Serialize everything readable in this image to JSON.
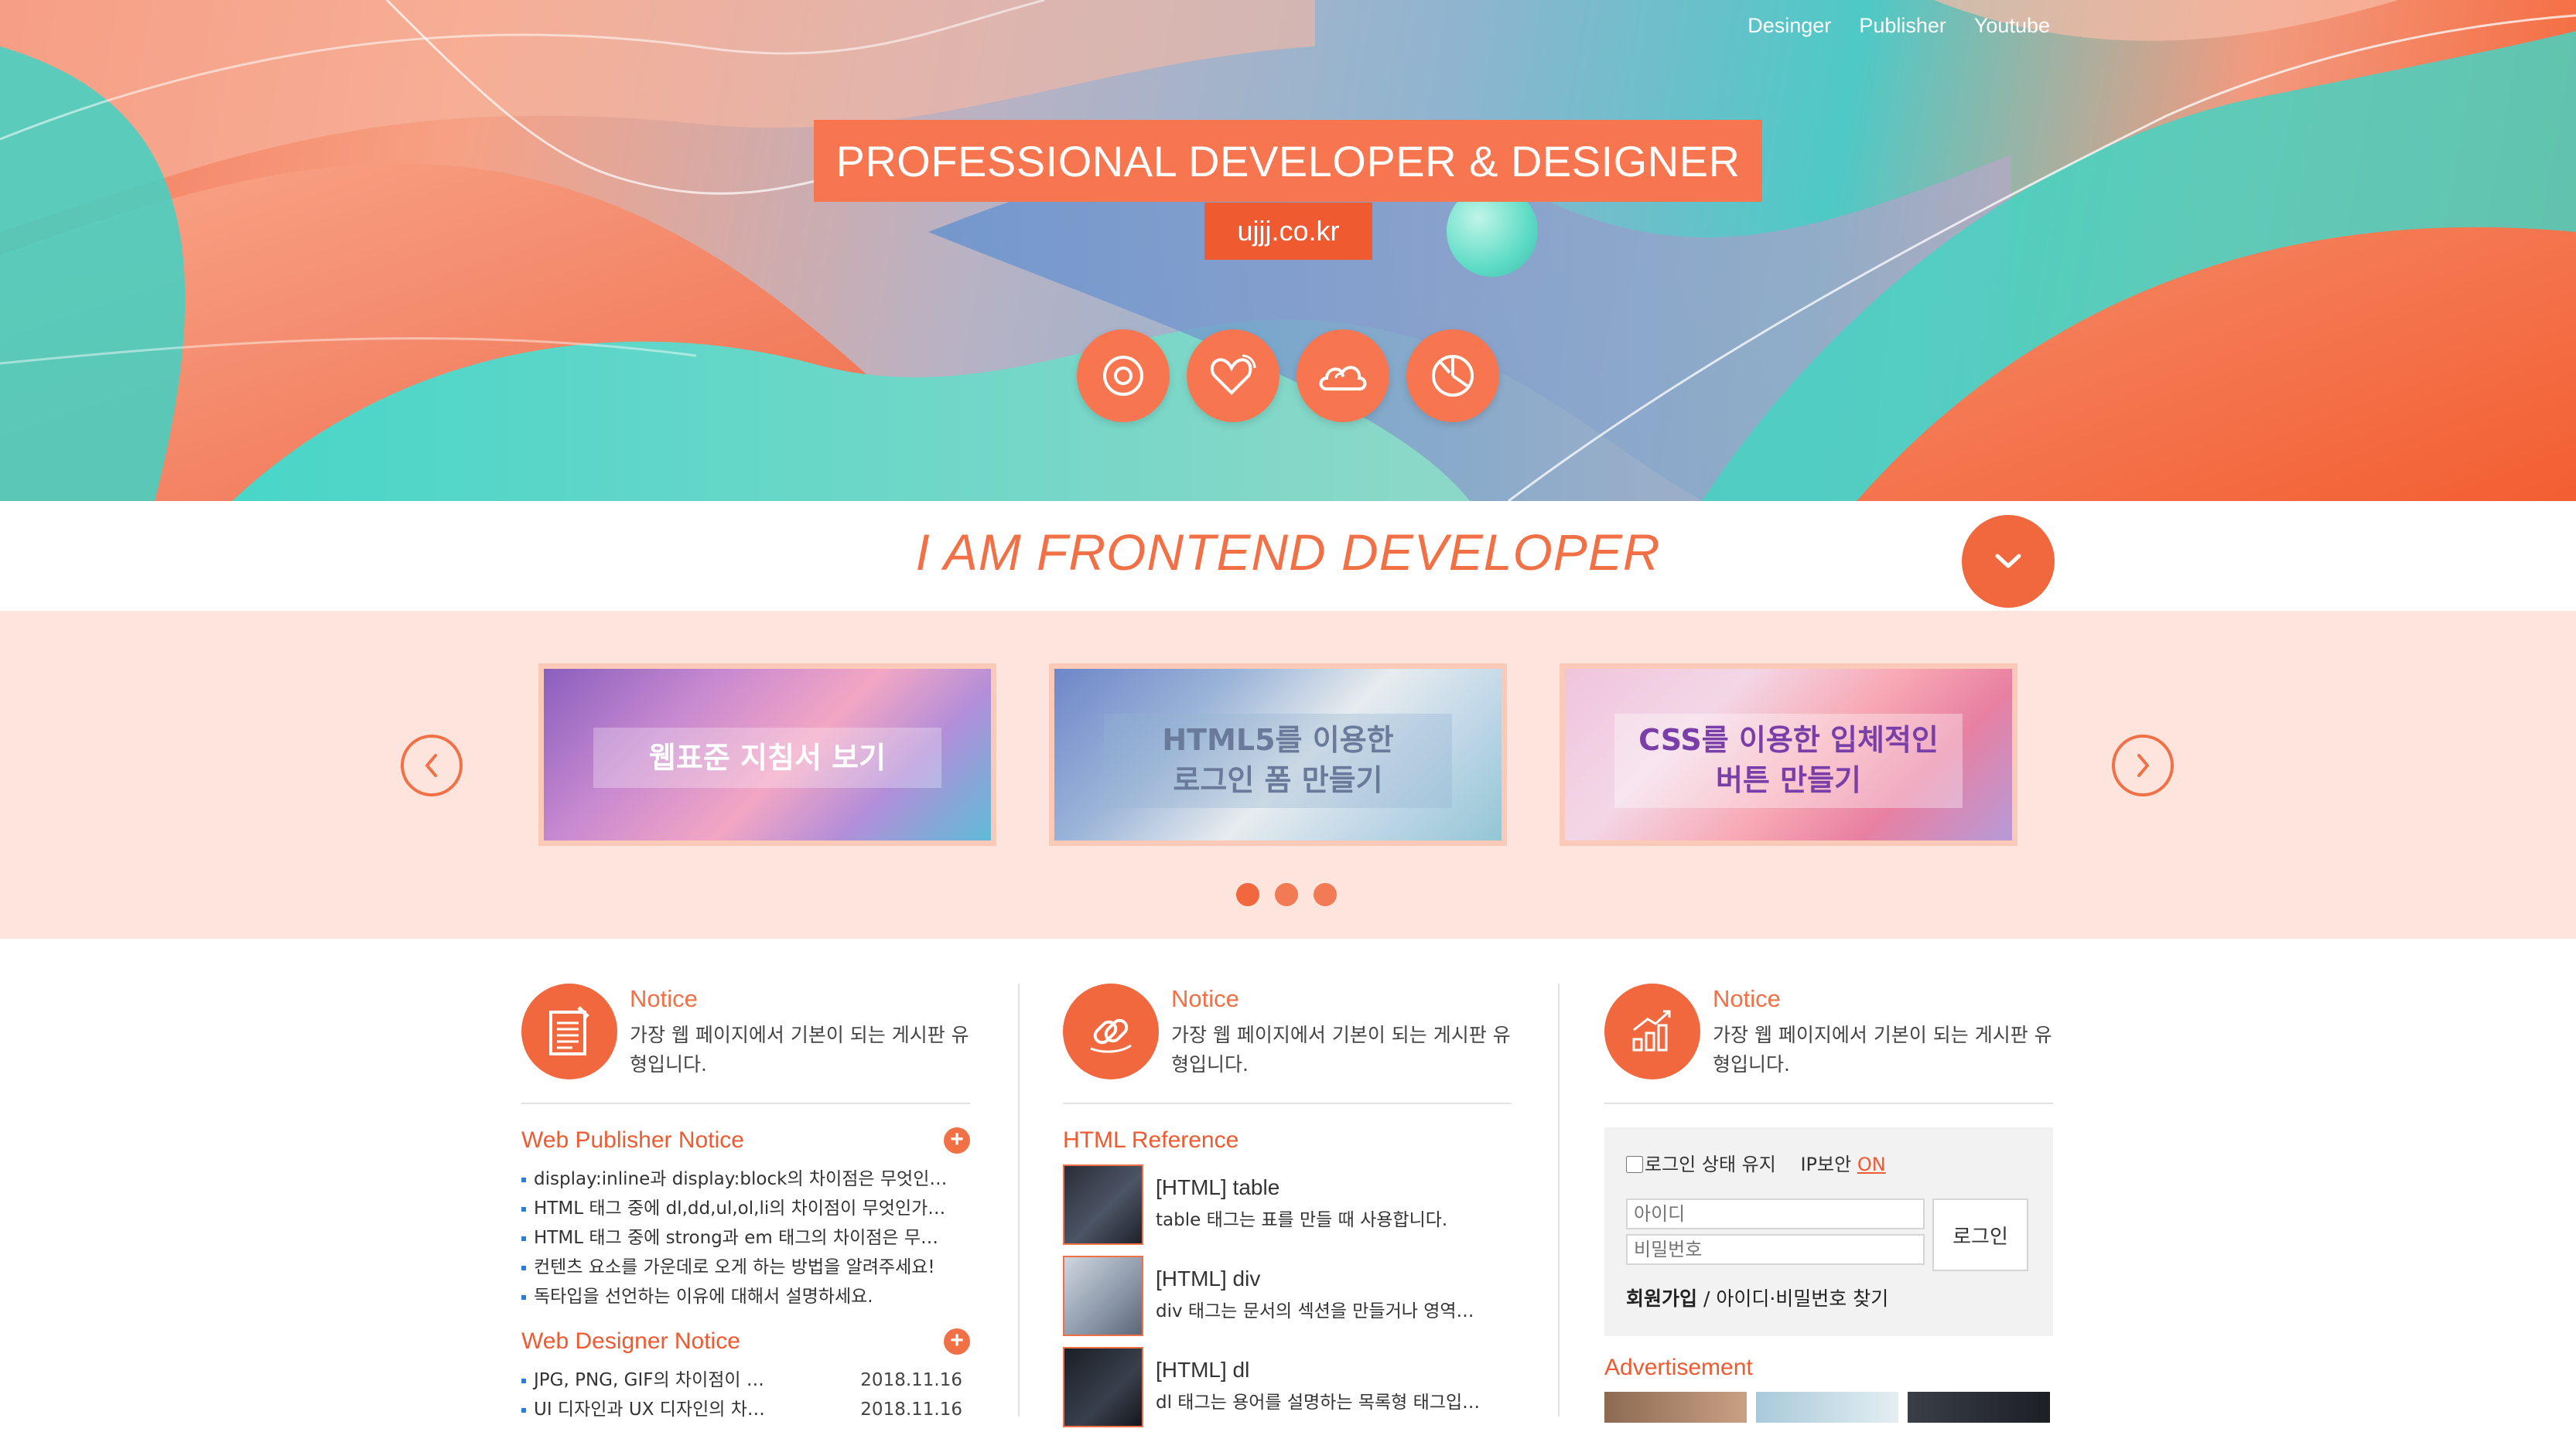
{
  "nav": {
    "items": [
      "Desinger",
      "Publisher",
      "Youtube"
    ]
  },
  "hero": {
    "title": "PROFESSIONAL DEVELOPER & DESIGNER",
    "subtitle": "ujjj.co.kr",
    "icons": [
      "target-icon",
      "heart-icon",
      "cloud-icon",
      "pie-chart-icon"
    ]
  },
  "banner": {
    "heading": "I AM FRONTEND DEVELOPER"
  },
  "slider": {
    "slides": [
      {
        "caption_line1": "웹표준 지침서 보기",
        "caption_line2": ""
      },
      {
        "caption_line1": "HTML5를 이용한",
        "caption_line2": "로그인 폼 만들기"
      },
      {
        "caption_line1": "CSS를 이용한 입체적인",
        "caption_line2": "버튼 만들기"
      }
    ]
  },
  "columns": [
    {
      "title": "Notice",
      "desc": "가장 웹 페이지에서 기본이 되는 게시판 유형입니다.",
      "icon": "document-icon"
    },
    {
      "title": "Notice",
      "desc": "가장 웹 페이지에서 기본이 되는 게시판 유형입니다.",
      "icon": "link-icon"
    },
    {
      "title": "Notice",
      "desc": "가장 웹 페이지에서 기본이 되는 게시판 유형입니다.",
      "icon": "growth-chart-icon"
    }
  ],
  "publisher": {
    "title": "Web Publisher Notice",
    "items": [
      "display:inline과 display:block의 차이점은 무엇인…",
      "HTML 태그 중에 dl,dd,ul,ol,li의 차이점이 무엇인가…",
      "HTML 태그 중에 strong과 em 태그의 차이점은 무…",
      "컨텐츠 요소를 가운데로 오게 하는 방법을 알려주세요!",
      "독타입을 선언하는 이유에 대해서 설명하세요."
    ]
  },
  "designer": {
    "title": "Web Designer Notice",
    "items": [
      {
        "text": "JPG, PNG, GIF의 차이점이 …",
        "date": "2018.11.16"
      },
      {
        "text": "UI 디자인과 UX 디자인의 차…",
        "date": "2018.11.16"
      }
    ]
  },
  "reference": {
    "title": "HTML Reference",
    "items": [
      {
        "title": "[HTML] table",
        "desc": "table 태그는 표를 만들 때 사용합니다."
      },
      {
        "title": "[HTML] div",
        "desc": "div 태그는 문서의 섹션을 만들거나 영역…"
      },
      {
        "title": "[HTML] dl",
        "desc": "dl 태그는 용어를 설명하는 목록형 태그입…"
      }
    ]
  },
  "login": {
    "keep_label": "로그인 상태 유지",
    "ip_label": "IP보안",
    "ip_state": "ON",
    "id_placeholder": "아이디",
    "pw_placeholder": "비밀번호",
    "button": "로그인",
    "join": "회원가입",
    "find": "/ 아이디·비밀번호 찾기"
  },
  "advertisement": {
    "title": "Advertisement"
  },
  "colors": {
    "accent": "#f27046",
    "accent_dark": "#f05a30",
    "slider_bg": "#fde4dc"
  }
}
